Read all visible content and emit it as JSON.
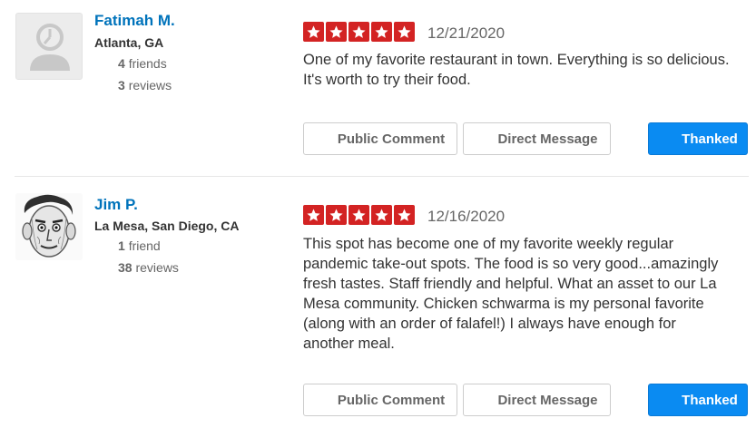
{
  "reviews": [
    {
      "user": {
        "name": "Fatimah M.",
        "location": "Atlanta, GA",
        "friends_count": "4",
        "friends_label": "friends",
        "reviews_count": "3",
        "reviews_label": "reviews",
        "avatar": "default-avatar-icon"
      },
      "rating": 5,
      "date": "12/21/2020",
      "text": "One of my favorite restaurant in town. Everything is so delicious. It's worth to try their food.",
      "buttons": {
        "public_comment": "Public Comment",
        "direct_message": "Direct Message",
        "thanked": "Thanked"
      }
    },
    {
      "user": {
        "name": "Jim P.",
        "location": "La Mesa, San Diego, CA",
        "friends_count": "1",
        "friends_label": "friend",
        "reviews_count": "38",
        "reviews_label": "reviews",
        "avatar": "user-photo"
      },
      "rating": 5,
      "date": "12/16/2020",
      "text": "This spot has become one of my favorite weekly regular pandemic take-out spots.  The food is so very good...amazingly fresh tastes. Staff friendly and helpful. What an asset  to our La Mesa community.  Chicken schwarma is my personal favorite (along with an order of falafel!) I always have enough for another meal.",
      "buttons": {
        "public_comment": "Public Comment",
        "direct_message": "Direct Message",
        "thanked": "Thanked"
      }
    }
  ],
  "colors": {
    "star_red": "#d32323",
    "link_blue": "#0073bb",
    "button_blue": "#0a8bf2"
  }
}
